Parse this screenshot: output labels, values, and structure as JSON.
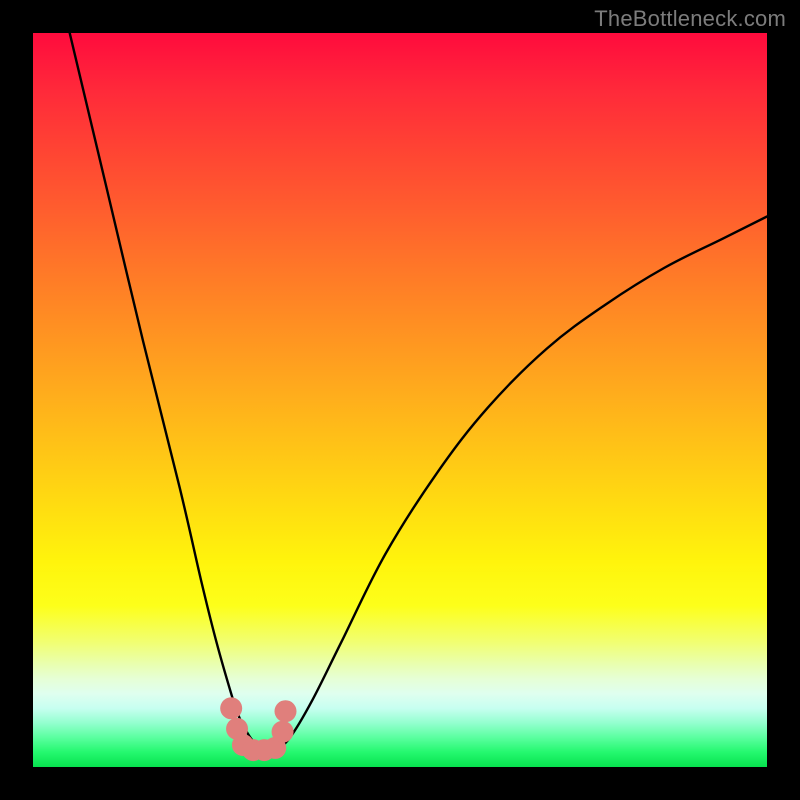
{
  "watermark": "TheBottleneck.com",
  "chart_data": {
    "type": "line",
    "title": "",
    "xlabel": "",
    "ylabel": "",
    "xlim": [
      0,
      100
    ],
    "ylim": [
      0,
      100
    ],
    "series": [
      {
        "name": "curve",
        "x": [
          5,
          10,
          15,
          20,
          23,
          25,
          27,
          28,
          29,
          30,
          31,
          32,
          33,
          35,
          38,
          42,
          48,
          55,
          62,
          70,
          78,
          86,
          94,
          100
        ],
        "values": [
          100,
          79,
          58,
          38,
          25,
          17,
          10,
          7,
          5,
          3.5,
          2.7,
          2.3,
          2.3,
          4,
          9,
          17,
          29,
          40,
          49,
          57,
          63,
          68,
          72,
          75
        ]
      }
    ],
    "markers": [
      {
        "x": 27.0,
        "y": 8.0
      },
      {
        "x": 27.8,
        "y": 5.2
      },
      {
        "x": 28.6,
        "y": 3.0
      },
      {
        "x": 30.0,
        "y": 2.3
      },
      {
        "x": 31.5,
        "y": 2.3
      },
      {
        "x": 33.0,
        "y": 2.6
      },
      {
        "x": 34.0,
        "y": 4.8
      },
      {
        "x": 34.4,
        "y": 7.6
      }
    ],
    "gradient_stops": [
      {
        "pos": 0,
        "color": "#ff0b3d"
      },
      {
        "pos": 50,
        "color": "#ffae1f"
      },
      {
        "pos": 78,
        "color": "#fdff1a"
      },
      {
        "pos": 92,
        "color": "#c7fff0"
      },
      {
        "pos": 100,
        "color": "#07e24f"
      }
    ]
  }
}
